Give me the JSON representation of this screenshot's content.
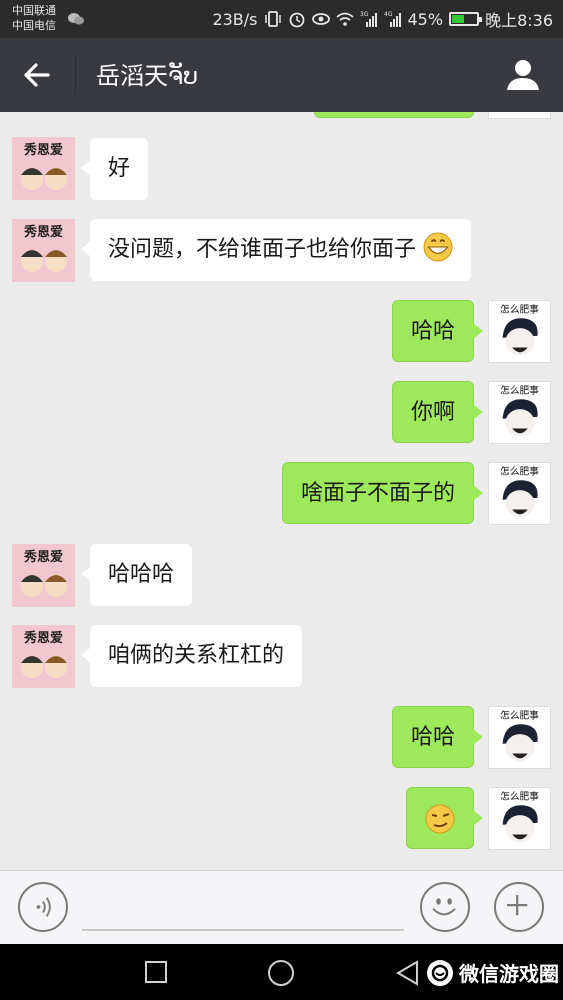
{
  "status_bar": {
    "carrier_1": "中国联通",
    "carrier_2": "中国电信",
    "net_speed": "23B/s",
    "signal_1": "3G",
    "signal_2": "4G",
    "battery": "45%",
    "time": "晚上8:36"
  },
  "header": {
    "title": "岳滔天ຈັບ"
  },
  "avatars": {
    "left_label": "秀恩爱",
    "right_label": "怎么肥事"
  },
  "messages": [
    {
      "side": "left",
      "text": "好"
    },
    {
      "side": "left",
      "text": "没问题，不给谁面子也给你面子",
      "emoji": "grin"
    },
    {
      "side": "right",
      "text": "哈哈"
    },
    {
      "side": "right",
      "text": "你啊"
    },
    {
      "side": "right",
      "text": "啥面子不面子的"
    },
    {
      "side": "left",
      "text": "哈哈哈"
    },
    {
      "side": "left",
      "text": "咱俩的关系杠杠的"
    },
    {
      "side": "right",
      "text": "哈哈"
    },
    {
      "side": "right",
      "text": "",
      "emoji": "smirk"
    }
  ],
  "watermark": "微信游戏圈",
  "colors": {
    "title_bar": "#393a3f",
    "chat_bg": "#ebebeb",
    "sent_bubble": "#9ee85c",
    "received_bubble": "#ffffff"
  }
}
